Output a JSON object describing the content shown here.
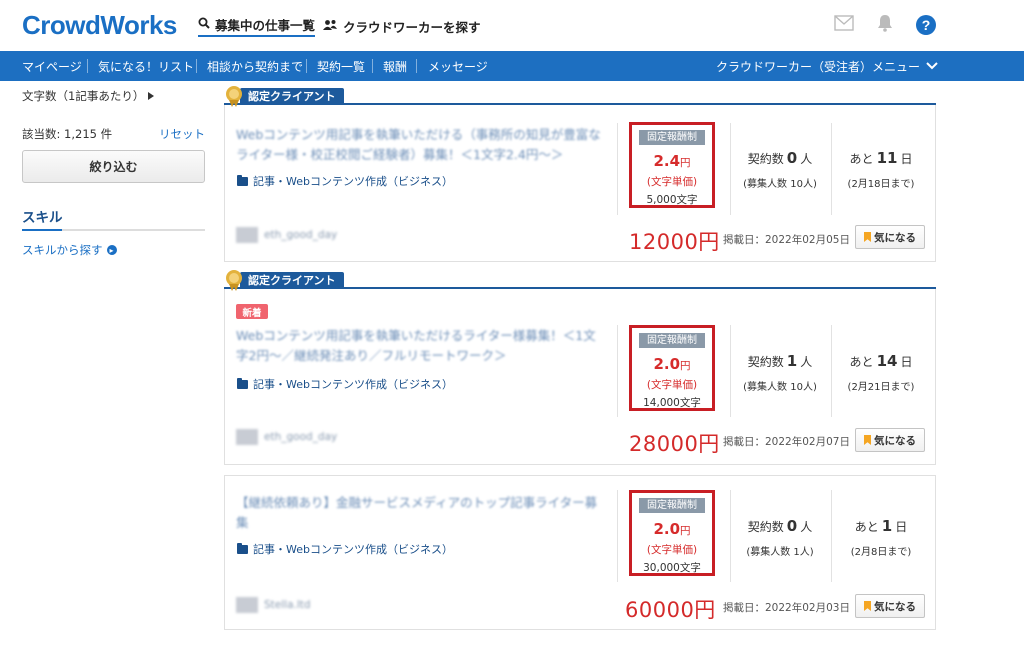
{
  "header": {
    "logo": "CrowdWorks",
    "links": [
      "募集中の仕事一覧",
      "クラウドワーカーを探す"
    ],
    "icons": [
      "mail-icon",
      "bell-icon",
      "help-icon"
    ],
    "help_glyph": "?"
  },
  "nav": {
    "items": [
      "マイページ",
      "気になる！リスト",
      "相談から契約まで",
      "契約一覧",
      "報酬",
      "メッセージ"
    ],
    "menu": "クラウドワーカー（受注者）メニュー"
  },
  "sidebar": {
    "filter": "文字数（1記事あたり）",
    "count": "該当数: 1,215 件",
    "reset": "リセット",
    "filter_button": "絞り込む",
    "skill_heading": "スキル",
    "skill_search": "スキルから探す"
  },
  "cert_label": "認定クライアント",
  "jobs": [
    {
      "title": "Webコンテンツ用記事を執筆いただける（事務所の知見が豊富なライター様・校正校閲ご経験者）募集！＜1文字2.4円〜＞",
      "category": "記事・Webコンテンツ作成（ビジネス）",
      "client": "eth_good_day",
      "pay_type": "固定報酬制",
      "price": "2.4",
      "price_unit_small": "円",
      "price_unit": "(文字単価)",
      "chars": "5,000文字",
      "contract_label": "契約数",
      "contracts": "0",
      "person": "人",
      "recruit": "(募集人数 10人)",
      "remain_label": "あと",
      "remain": "11",
      "day": "日",
      "deadline": "(2月18日まで)",
      "total": "12000円",
      "posted": "掲載日：2022年02月05日",
      "fav": "気になる"
    },
    {
      "badge": "新着",
      "title": "Webコンテンツ用記事を執筆いただけるライター様募集！＜1文字2円〜／継続発注あり／フルリモートワーク＞",
      "category": "記事・Webコンテンツ作成（ビジネス）",
      "client": "eth_good_day",
      "pay_type": "固定報酬制",
      "price": "2.0",
      "price_unit_small": "円",
      "price_unit": "(文字単価)",
      "chars": "14,000文字",
      "contract_label": "契約数",
      "contracts": "1",
      "person": "人",
      "recruit": "(募集人数 10人)",
      "remain_label": "あと",
      "remain": "14",
      "day": "日",
      "deadline": "(2月21日まで)",
      "total": "28000円",
      "posted": "掲載日：2022年02月07日",
      "fav": "気になる"
    },
    {
      "title": "【継続依頼あり】金融サービスメディアのトップ記事ライター募集",
      "category": "記事・Webコンテンツ作成（ビジネス）",
      "client": "Stella.ltd",
      "pay_type": "固定報酬制",
      "price": "2.0",
      "price_unit_small": "円",
      "price_unit": "(文字単価)",
      "chars": "30,000文字",
      "contract_label": "契約数",
      "contracts": "0",
      "person": "人",
      "recruit": "(募集人数 1人)",
      "remain_label": "あと",
      "remain": "1",
      "day": "日",
      "deadline": "(2月8日まで)",
      "total": "60000円",
      "posted": "掲載日：2022年02月03日",
      "fav": "気になる"
    }
  ]
}
